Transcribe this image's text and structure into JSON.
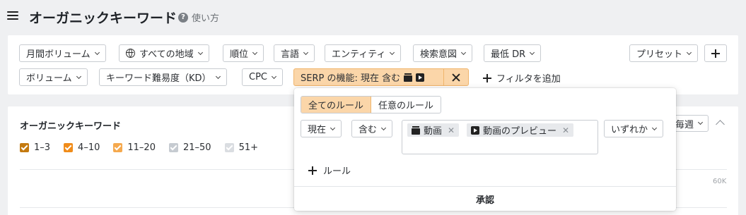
{
  "header": {
    "title": "オーガニックキーワード",
    "help_label": "使い方"
  },
  "filters": {
    "row1": [
      "月間ボリューム",
      "すべての地域",
      "順位",
      "言語",
      "エンティティ",
      "検索意図",
      "最低 DR"
    ],
    "row2": [
      "ボリューム",
      "キーワード難易度（KD）",
      "CPC"
    ],
    "preset_label": "プリセット",
    "serp_chip_label": "SERP の機能: 現在 含む",
    "add_filter_label": "フィルタを追加"
  },
  "content": {
    "section_title": "オーガニックキーワード",
    "legend": [
      {
        "label": "1–3",
        "color": "#c47a10"
      },
      {
        "label": "4–10",
        "color": "#f08c1a"
      },
      {
        "label": "11–20",
        "color": "#f5a94e"
      },
      {
        "label": "21–50",
        "color": "#c6cbd1"
      },
      {
        "label": "51+",
        "color": "#dadde1"
      }
    ],
    "period_label": "毎週",
    "axis_tick": "60K"
  },
  "popover": {
    "seg_all": "全てのルール",
    "seg_any": "任意のルール",
    "state_select": "現在",
    "op_select": "含む",
    "tags": [
      "動画",
      "動画のプレビュー"
    ],
    "match_select": "いずれか",
    "add_rule_label": "ルール",
    "confirm_label": "承認"
  },
  "colors": {
    "accent": "#fbd6a9",
    "accent_border": "#f0b56c"
  }
}
